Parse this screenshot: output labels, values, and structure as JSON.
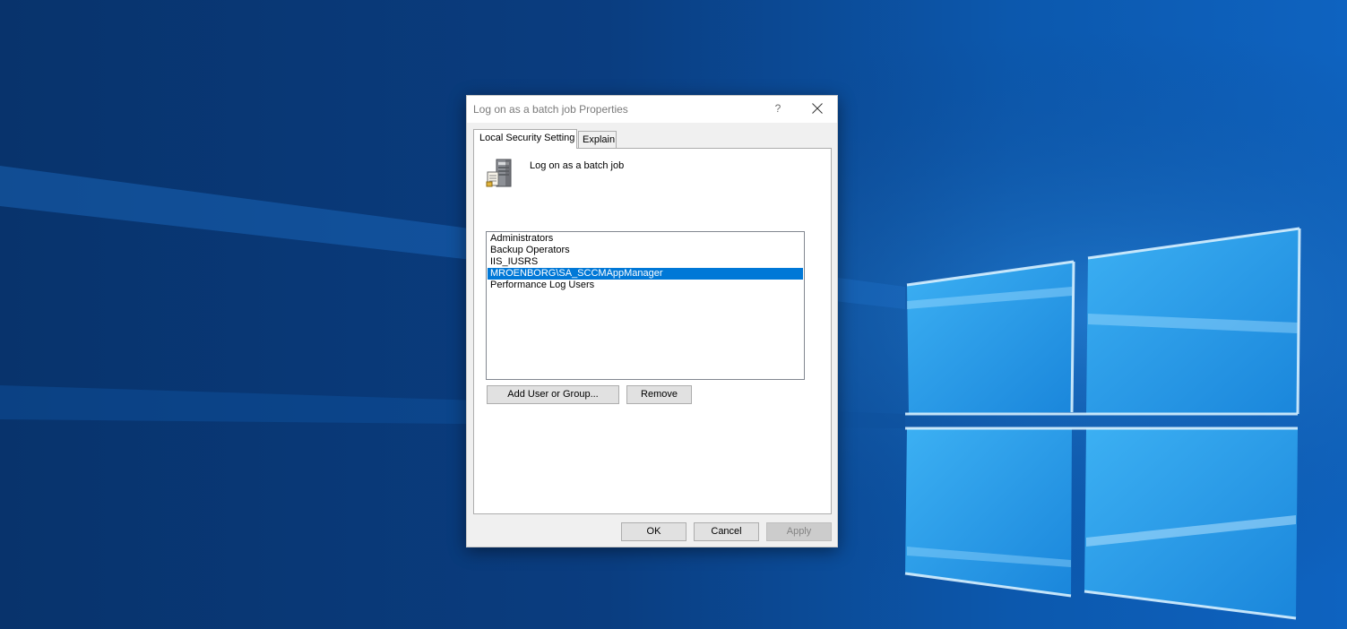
{
  "dialog": {
    "title": "Log on as a batch job Properties",
    "help_label": "?",
    "tabs": [
      {
        "label": "Local Security Setting",
        "active": true
      },
      {
        "label": "Explain",
        "active": false
      }
    ],
    "policy_name": "Log on as a batch job",
    "policy_icon": "server-policy-icon",
    "list_items": [
      {
        "label": "Administrators",
        "selected": false
      },
      {
        "label": "Backup Operators",
        "selected": false
      },
      {
        "label": "IIS_IUSRS",
        "selected": false
      },
      {
        "label": "MROENBORG\\SA_SCCMAppManager",
        "selected": true
      },
      {
        "label": "Performance Log Users",
        "selected": false
      }
    ],
    "add_button": "Add User or Group...",
    "remove_button": "Remove",
    "ok_button": "OK",
    "cancel_button": "Cancel",
    "apply_button": "Apply",
    "apply_enabled": false
  },
  "colors": {
    "selection": "#0078d7",
    "desktop_base": "#0a3a78",
    "desktop_glow": "#3fa6ee"
  }
}
